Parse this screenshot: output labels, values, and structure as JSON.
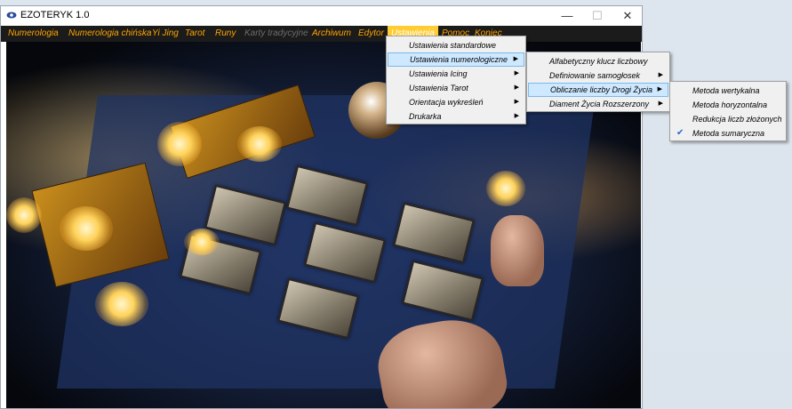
{
  "window": {
    "title": "EZOTERYK 1.0",
    "minimize": "—",
    "maximize": "☐",
    "close": "✕"
  },
  "menubar": [
    {
      "label": "Numerologia"
    },
    {
      "label": "Numerologia chińska"
    },
    {
      "label": "Yi Jing"
    },
    {
      "label": "Tarot"
    },
    {
      "label": "Runy"
    },
    {
      "label": "Karty tradycyjne"
    },
    {
      "label": "Archiwum"
    },
    {
      "label": "Edytor"
    },
    {
      "label": "Ustawienia"
    },
    {
      "label": "Pomoc"
    },
    {
      "label": "Koniec"
    }
  ],
  "settings_menu": [
    {
      "label": "Ustawienia standardowe",
      "arrow": ""
    },
    {
      "label": "Ustawienia numerologiczne",
      "arrow": "▶"
    },
    {
      "label": "Ustawienia Icing",
      "arrow": "▶"
    },
    {
      "label": "Ustawienia Tarot",
      "arrow": "▶"
    },
    {
      "label": "Orientacja wykreśleń",
      "arrow": "▶"
    },
    {
      "label": "Drukarka",
      "arrow": "▶"
    }
  ],
  "numerology_menu": [
    {
      "label": "Alfabetyczny klucz liczbowy",
      "arrow": ""
    },
    {
      "label": "Definiowanie samogłosek",
      "arrow": "▶"
    },
    {
      "label": "Obliczanie liczby Drogi Życia",
      "arrow": "▶"
    },
    {
      "label": "Diament Życia Rozszerzony",
      "arrow": "▶"
    }
  ],
  "life_path_menu": [
    {
      "label": "Metoda wertykalna",
      "check": ""
    },
    {
      "label": "Metoda horyzontalna",
      "check": ""
    },
    {
      "label": "Redukcja liczb złożonych",
      "check": ""
    },
    {
      "label": "Metoda sumaryczna",
      "check": "✔"
    }
  ],
  "colors": {
    "menubar_bg": "#1b1b1b",
    "menu_text": "#ffa500",
    "active_menu_bg": "#ffcc33",
    "highlight": "#cde8ff"
  }
}
